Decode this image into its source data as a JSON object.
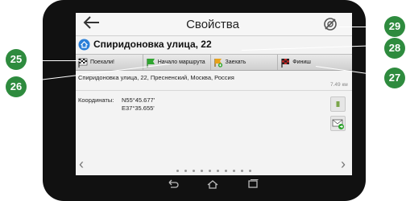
{
  "screen": {
    "title": "Свойства",
    "address_title": "Спиридоновка улица, 22",
    "toolbar": {
      "go_label": "Поехали!",
      "start_label": "Начало маршрута",
      "via_label": "Заехать",
      "finish_label": "Финиш"
    },
    "full_address": "Спиридоновка улица, 22, Пресненский, Москва, Россия",
    "distance": "7.49 км",
    "coordinates": {
      "label": "Координаты:",
      "lat": "N55°45.677'",
      "lon": "E37°35.655'"
    },
    "pager": {
      "prev": "‹",
      "next": "›",
      "dot_count": 10
    }
  },
  "callouts": {
    "c25": "25",
    "c26": "26",
    "c27": "27",
    "c28": "28",
    "c29": "29"
  },
  "colors": {
    "callout": "#2e8b3e",
    "device_bezel": "#111111"
  }
}
